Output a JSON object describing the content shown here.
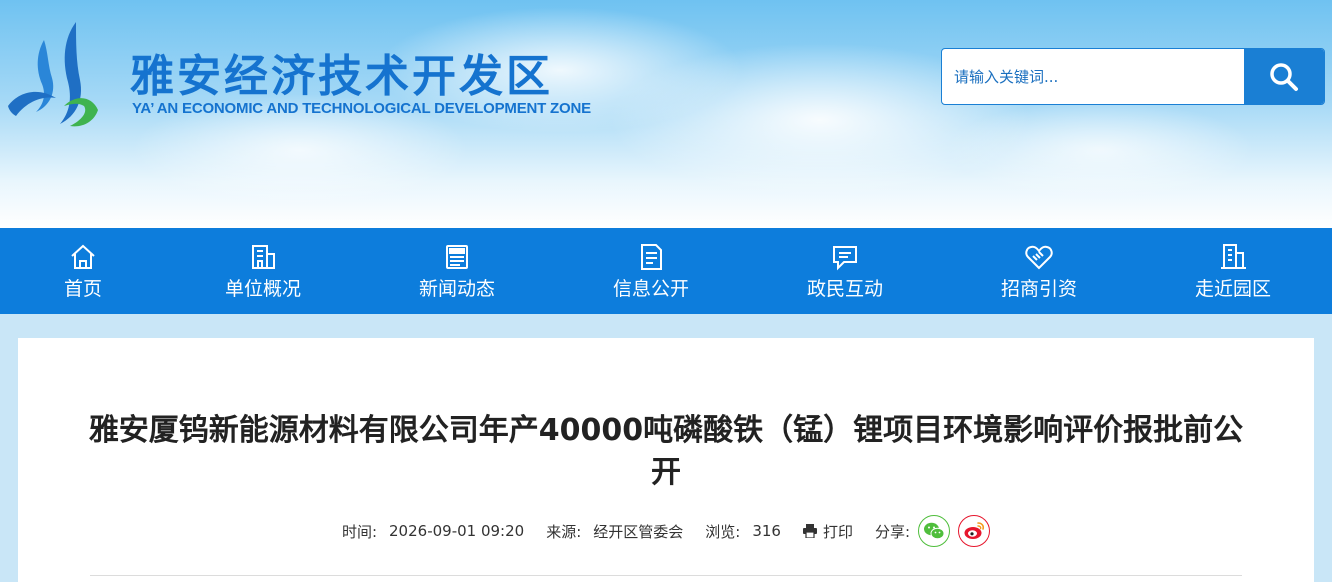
{
  "site": {
    "title": "雅安经济技术开发区",
    "subtitle": "YA’ AN ECONOMIC AND TECHNOLOGICAL DEVELOPMENT ZONE"
  },
  "search": {
    "placeholder": "请输入关键词..."
  },
  "nav": {
    "items": [
      {
        "label": "首页",
        "icon": "home-icon"
      },
      {
        "label": "单位概况",
        "icon": "building-icon"
      },
      {
        "label": "新闻动态",
        "icon": "news-icon"
      },
      {
        "label": "信息公开",
        "icon": "document-icon"
      },
      {
        "label": "政民互动",
        "icon": "chat-icon"
      },
      {
        "label": "招商引资",
        "icon": "handshake-icon"
      },
      {
        "label": "走近园区",
        "icon": "city-icon"
      }
    ]
  },
  "article": {
    "title": "雅安厦钨新能源材料有限公司年产40000吨磷酸铁（锰）锂项目环境影响评价报批前公开",
    "meta": {
      "time_label": "时间:",
      "time_value": "2026-09-01 09:20",
      "source_label": "来源:",
      "source_value": "经开区管委会",
      "views_label": "浏览:",
      "views_value": "316",
      "print_label": "打印",
      "share_label": "分享:"
    }
  },
  "colors": {
    "brand_blue": "#1573cf",
    "nav_blue": "#0d7ddc",
    "wechat_green": "#4fbe3c",
    "weibo_red": "#e6162d"
  }
}
